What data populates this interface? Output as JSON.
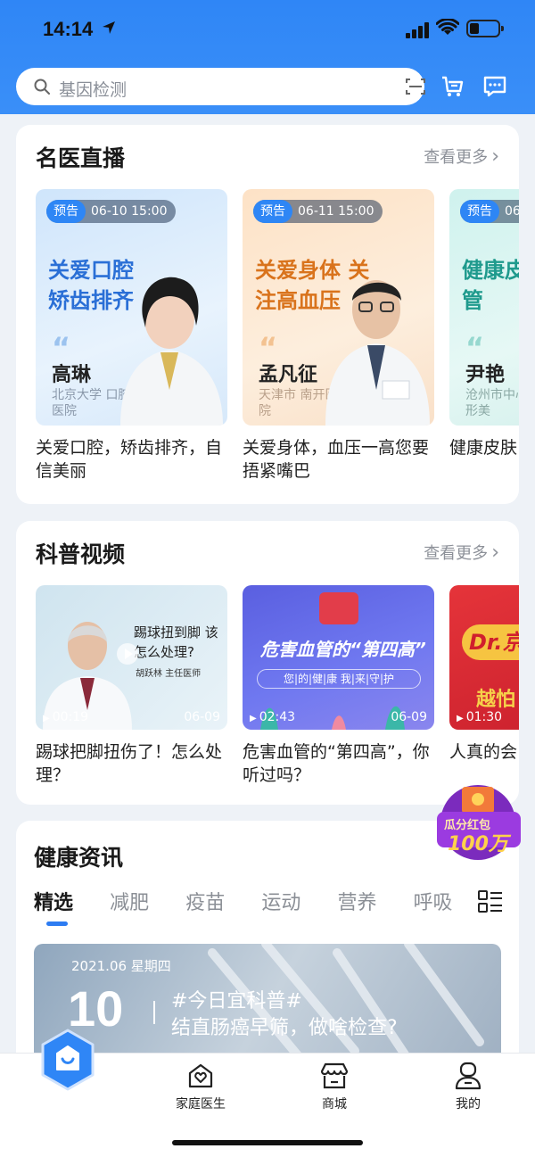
{
  "status_bar": {
    "time": "14:14"
  },
  "search": {
    "placeholder": "基因检测"
  },
  "live": {
    "title": "名医直播",
    "more": "查看更多",
    "items": [
      {
        "tag": "预告",
        "time": "06-10 15:00",
        "headline": "关爱口腔 矫齿排齐",
        "doctor": "高琳",
        "hospital": "北京大学 口腔医院",
        "caption": "关爱口腔，矫齿排齐，自信美丽",
        "accent": "#2a6fd6"
      },
      {
        "tag": "预告",
        "time": "06-11 15:00",
        "headline": "关爱身体 关注高血压",
        "doctor": "孟凡征",
        "hospital": "天津市 南开医院",
        "caption": "关爱身体，血压一高您要捂紧嘴巴",
        "accent": "#d9731c"
      },
      {
        "tag": "预告",
        "time": "06",
        "headline": "健康皮 科学管",
        "doctor": "尹艳",
        "hospital": "沧州市中心 医学整形美",
        "caption": "健康皮肤",
        "accent": "#1f9a8d"
      }
    ]
  },
  "video": {
    "title": "科普视频",
    "more": "查看更多",
    "items": [
      {
        "duration": "00:19",
        "date": "06-09",
        "overlay_title": "踢球扭到脚 该怎么处理?",
        "overlay_sub": "胡跃林 主任医师",
        "caption": "踢球把脚扭伤了！怎么处理？"
      },
      {
        "duration": "02:43",
        "date": "06-09",
        "overlay_title": "危害血管的“第四高”",
        "overlay_sub": "您|的|健|康  我|来|守|护",
        "caption": "危害血管的“第四高”，你听过吗？"
      },
      {
        "duration": "01:30",
        "date": "",
        "overlay_title": "Dr.京",
        "overlay_sub": "越怕",
        "caption": "人真的会"
      }
    ]
  },
  "news": {
    "title": "健康资讯",
    "tabs": [
      "精选",
      "减肥",
      "疫苗",
      "运动",
      "营养",
      "呼吸"
    ],
    "active_tab": 0,
    "banner": {
      "date": "2021.06 星期四",
      "day": "10",
      "line1": "#今日宜科普#",
      "line2": "结直肠癌早筛，做啥检查?"
    }
  },
  "float_badge": {
    "line1": "瓜分红包",
    "line2": "100万"
  },
  "tabbar": {
    "items": [
      "家庭医生",
      "商城",
      "我的"
    ]
  }
}
